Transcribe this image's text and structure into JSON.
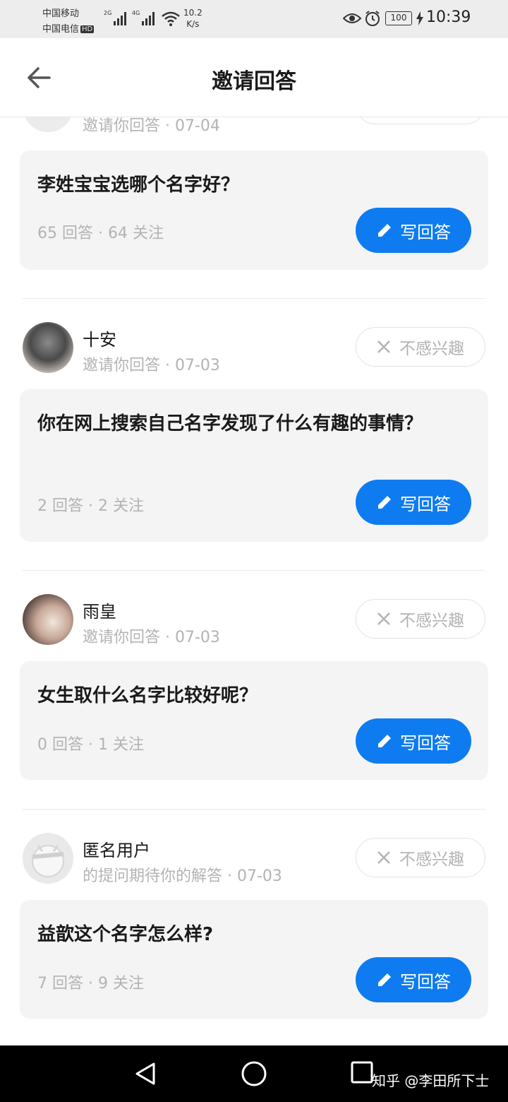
{
  "status_bar": {
    "carrier1": "中国移动",
    "carrier2": "中国电信",
    "hd_badge": "HD",
    "network1": "2G",
    "network2": "4G",
    "speed_value": "10.2",
    "speed_unit": "K/s",
    "battery": "100",
    "time": "10:39",
    "icons": [
      "signal-icon",
      "wifi-icon",
      "eye-icon",
      "alarm-icon",
      "battery-icon",
      "charging-icon"
    ]
  },
  "header": {
    "title": "邀请回答",
    "back_icon": "back-arrow-icon"
  },
  "partial_item": {
    "invite_text": "邀请你回答 · 07-04",
    "question": "李姓宝宝选哪个名字好？",
    "stats": "65 回答 · 64 关注",
    "write_label": "写回答"
  },
  "items": [
    {
      "user": "十安",
      "invite_text": "邀请你回答 · 07-03",
      "dismiss_label": "不感兴趣",
      "question": "你在网上搜索自己名字发现了什么有趣的事情？",
      "stats": "2 回答 · 2 关注",
      "write_label": "写回答"
    },
    {
      "user": "雨皇",
      "invite_text": "邀请你回答 · 07-03",
      "dismiss_label": "不感兴趣",
      "question": "女生取什么名字比较好呢？",
      "stats": "0 回答 · 1 关注",
      "write_label": "写回答"
    },
    {
      "user": "匿名用户",
      "invite_text": "的提问期待你的解答 · 07-03",
      "dismiss_label": "不感兴趣",
      "question": "益歆这个名字怎么样?",
      "stats": "7 回答 · 9 关注",
      "write_label": "写回答"
    }
  ],
  "nav_bar": {
    "watermark": "知乎 @李田所下士",
    "icons": [
      "nav-back-icon",
      "nav-home-icon",
      "nav-recents-icon"
    ]
  },
  "colors": {
    "accent": "#0e7cf0",
    "card_bg": "#f4f4f4",
    "meta_text": "#b3b3b3"
  }
}
